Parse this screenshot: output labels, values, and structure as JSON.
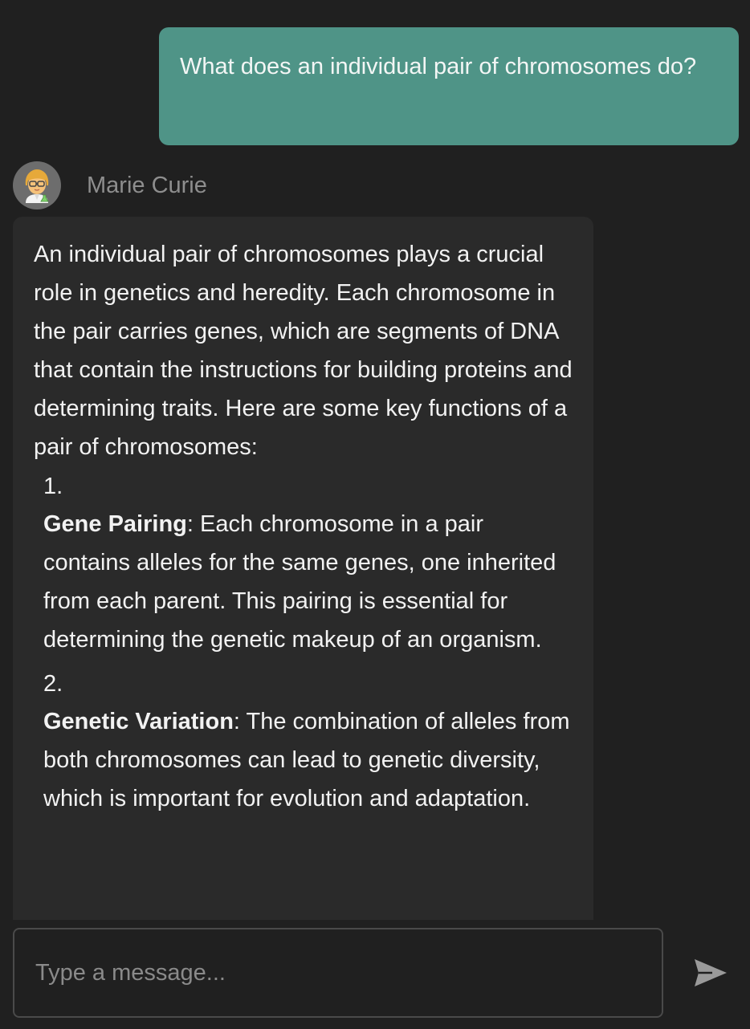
{
  "user_message": {
    "text": "What does an individual pair of chromosomes do?"
  },
  "assistant": {
    "name": "Marie Curie",
    "avatar_icon": "scientist-woman-icon",
    "intro": "An individual pair of chromosomes plays a crucial role in genetics and heredity. Each chromosome in the pair carries genes, which are segments of DNA that contain the instructions for building proteins and determining traits. Here are some key functions of a pair of chromosomes:",
    "items": [
      {
        "number": "1.",
        "title": "Gene Pairing",
        "text": ": Each chromosome in a pair contains alleles for the same genes, one inherited from each parent. This pairing is essential for determining the genetic makeup of an organism."
      },
      {
        "number": "2.",
        "title": "Genetic Variation",
        "text": ": The combination of alleles from both chromosomes can lead to genetic diversity, which is important for evolution and adaptation."
      }
    ]
  },
  "composer": {
    "placeholder": "Type a message...",
    "value": "",
    "send_icon": "send-icon"
  },
  "colors": {
    "background": "#202020",
    "user_bubble": "#4f9487",
    "assistant_bubble": "#2a2a2a",
    "muted_text": "#8e8e8e"
  }
}
